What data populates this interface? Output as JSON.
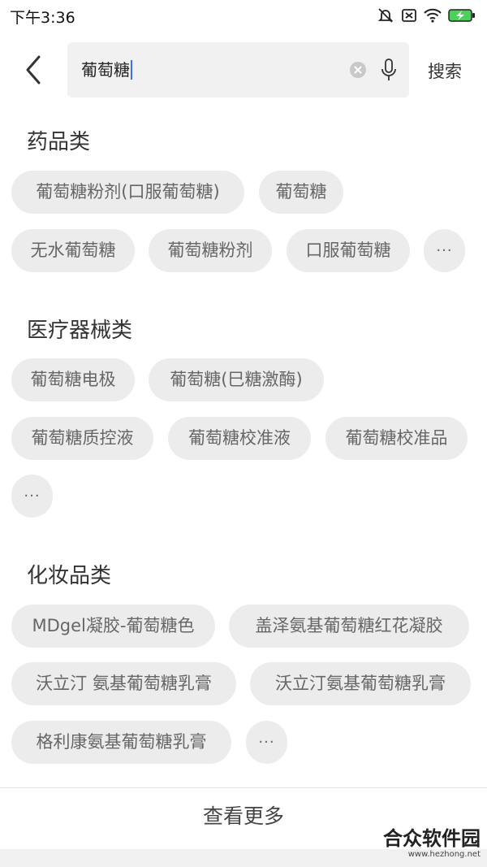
{
  "status_bar": {
    "time": "下午3:36",
    "icons": [
      "mute-bell-icon",
      "sim-off-icon",
      "wifi-icon",
      "battery-charging-icon"
    ]
  },
  "search": {
    "query": "葡萄糖",
    "submit_label": "搜索",
    "icons": [
      "back-arrow-icon",
      "clear-icon",
      "microphone-icon"
    ]
  },
  "sections": [
    {
      "title": "药品类",
      "chips": [
        "葡萄糖粉剂(口服葡萄糖)",
        "葡萄糖",
        "无水葡萄糖",
        "葡萄糖粉剂",
        "口服葡萄糖",
        "···"
      ]
    },
    {
      "title": "医疗器械类",
      "chips": [
        "葡萄糖电极",
        "葡萄糖(巳糖激酶)",
        "葡萄糖质控液",
        "葡萄糖校准液",
        "葡萄糖校准品",
        "···"
      ]
    },
    {
      "title": "化妆品类",
      "chips": [
        "MDgel凝胶-葡萄糖色",
        "盖泽氨基葡萄糖红花凝胶",
        "沃立汀 氨基葡萄糖乳膏",
        "沃立汀氨基葡萄糖乳膏",
        "格利康氨基葡萄糖乳膏",
        "···"
      ]
    }
  ],
  "footer": {
    "view_more_label": "查看更多"
  },
  "watermark": {
    "title": "合众软件园",
    "url": "www.hezhong.net"
  },
  "colors": {
    "chip_bg": "#ececec",
    "chip_text": "#666666",
    "caret": "#3a6ff0"
  }
}
